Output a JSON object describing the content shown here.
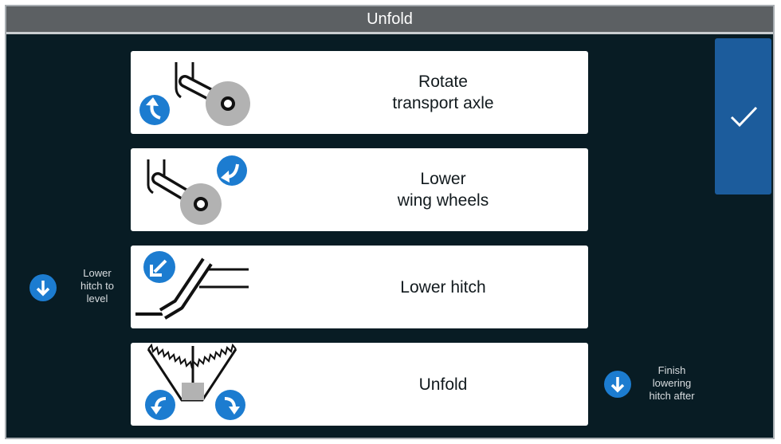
{
  "window": {
    "title": "Unfold"
  },
  "steps": [
    {
      "label": "Rotate\ntransport axle",
      "icon": "rotate-ccw-arrow-icon"
    },
    {
      "label": "Lower\nwing wheels",
      "icon": "rotate-cw-arrow-icon"
    },
    {
      "label": "Lower hitch",
      "icon": "down-left-arrow-icon"
    },
    {
      "label": "Unfold",
      "icon": "unfold-arrows-icon"
    }
  ],
  "confirm": {
    "icon": "checkmark-icon"
  },
  "notes": {
    "left": "Lower\nhitch to\nlevel",
    "right": "Finish\nlowering\nhitch after"
  },
  "colors": {
    "background": "#081c24",
    "titlebar": "#5c6063",
    "accent": "#1c7cd0",
    "confirm": "#1c5c9c"
  }
}
